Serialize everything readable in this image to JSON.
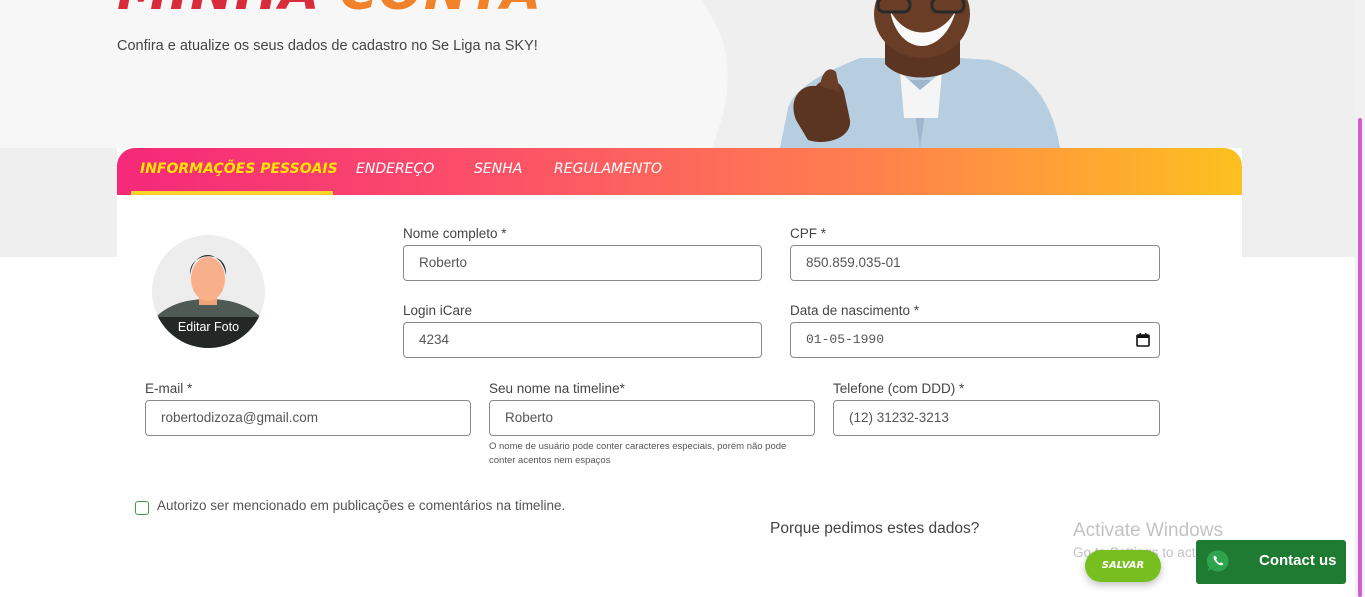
{
  "hero": {
    "title_part1": "MINHA",
    "title_part2": "CONTA",
    "subtitle": "Confira e atualize os seus dados de cadastro no Se Liga na SKY!"
  },
  "tabs": [
    {
      "label": "INFORMAÇÕES PESSOAIS",
      "active": true
    },
    {
      "label": "ENDEREÇO",
      "active": false
    },
    {
      "label": "SENHA",
      "active": false
    },
    {
      "label": "REGULAMENTO",
      "active": false
    }
  ],
  "avatar": {
    "edit_label": "Editar Foto",
    "icon": "person-avatar"
  },
  "form": {
    "full_name": {
      "label": "Nome completo *",
      "value": "Roberto"
    },
    "cpf": {
      "label": "CPF *",
      "value": "850.859.035-01"
    },
    "login": {
      "label": "Login iCare",
      "value": "4234"
    },
    "birthdate": {
      "label": "Data de nascimento *",
      "value": "01-05-1990",
      "icon": "calendar-icon"
    },
    "email": {
      "label": "E-mail *",
      "value": "robertodizoza@gmail.com"
    },
    "timeline_name": {
      "label": "Seu nome na timeline*",
      "value": "Roberto",
      "hint": "O nome de usuário pode conter caracteres especiais, porém não pode conter acentos nem espaços"
    },
    "phone": {
      "label": "Telefone (com DDD) *",
      "value": "(12) 31232-3213"
    },
    "consent": {
      "label": "Autorizo ser mencionado em publicações e comentários na timeline.",
      "checked": false
    },
    "why_link": "Porque pedimos estes dados?",
    "save_label": "SALVAR"
  },
  "watermark": {
    "line1": "Activate Windows",
    "line2": "Go to Settings to activate Windows."
  },
  "contact": {
    "label": "Contact us",
    "icon": "whatsapp-icon"
  },
  "colors": {
    "tab_gradient": [
      "#f5287a",
      "#fb4f69",
      "#fe7e4f",
      "#fdc11f"
    ],
    "active_tab": "#ffe600",
    "save_button": "#77bf1e",
    "contact_button": "#1f7a32",
    "title_red": "#d82b3c",
    "title_orange": "#f2822a"
  }
}
